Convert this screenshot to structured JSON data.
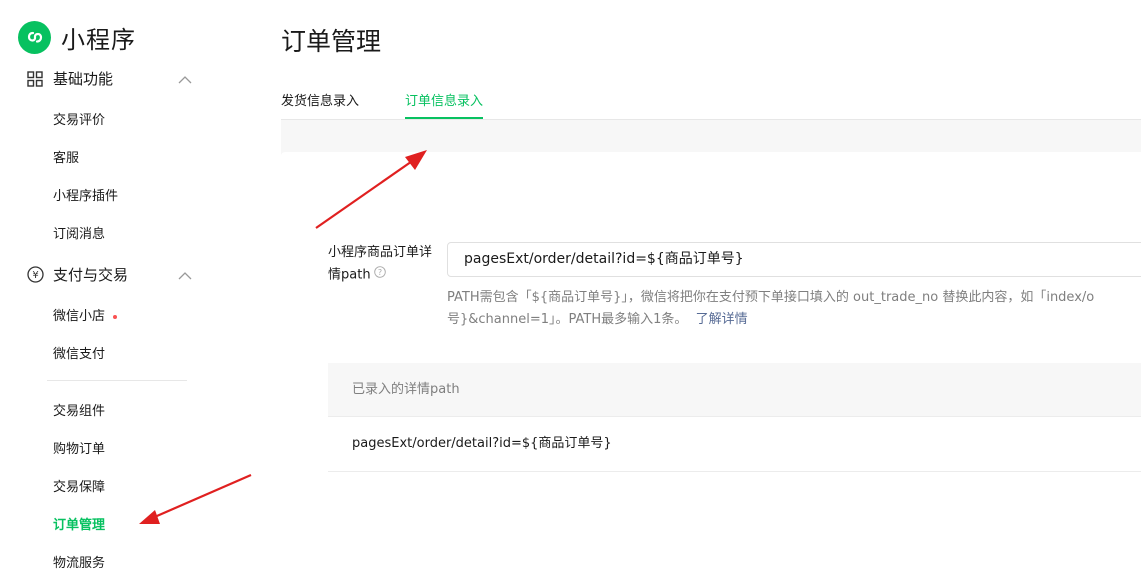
{
  "app": {
    "name": "小程序"
  },
  "sidebar": {
    "sections": [
      {
        "label": "基础功能",
        "icon": "grid-icon"
      },
      {
        "label": "支付与交易",
        "icon": "yen-circle-icon"
      }
    ],
    "basic_items": [
      {
        "label": "交易评价"
      },
      {
        "label": "客服"
      },
      {
        "label": "小程序插件"
      },
      {
        "label": "订阅消息"
      }
    ],
    "pay_items": [
      {
        "label": "微信小店",
        "badge_dot": true
      },
      {
        "label": "微信支付"
      }
    ],
    "trade_items": [
      {
        "label": "交易组件"
      },
      {
        "label": "购物订单"
      },
      {
        "label": "交易保障"
      },
      {
        "label": "订单管理",
        "active": true
      },
      {
        "label": "物流服务"
      }
    ]
  },
  "main": {
    "title": "订单管理",
    "tabs": [
      {
        "label": "发货信息录入"
      },
      {
        "label": "订单信息录入",
        "active": true
      }
    ],
    "form": {
      "label": "小程序商品订单详情path",
      "value": "pagesExt/order/detail?id=${商品订单号}",
      "hint": "PATH需包含「${商品订单号}」，微信将把你在支付预下单接口填入的 out_trade_no 替换此内容，如「index/o\n号}&channel=1」。PATH最多输入1条。",
      "hint_link": "了解详情"
    },
    "table": {
      "header": "已录入的详情path",
      "rows": [
        "pagesExt/order/detail?id=${商品订单号}"
      ]
    }
  },
  "colors": {
    "accent": "#07c160",
    "arrow": "#e02020",
    "link": "#576b95",
    "dot": "#fa5151"
  }
}
